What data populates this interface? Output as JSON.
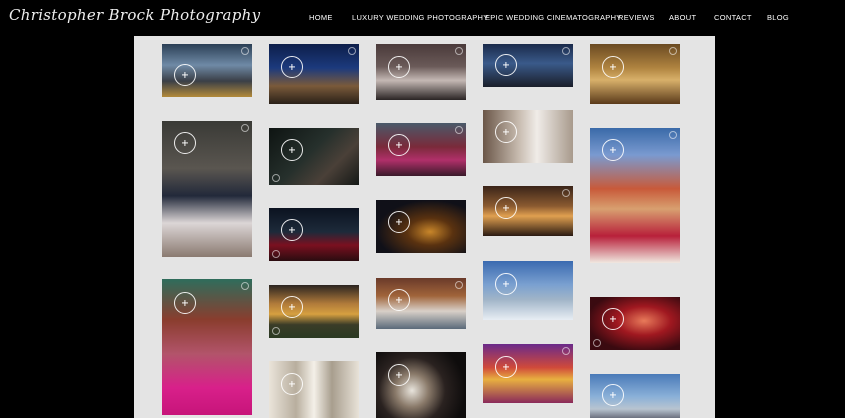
{
  "site": {
    "logo_text": "Christopher Brock Photography"
  },
  "nav": {
    "home": "HOME",
    "luxury": "LUXURY WEDDING PHOTOGRAPHY",
    "cinematography": "EPIC WEDDING CINEMATOGRAPHY",
    "reviews": "REVIEWS",
    "about": "ABOUT",
    "contact": "CONTACT",
    "blog": "BLOG"
  },
  "colors": {
    "page_background": "#000000",
    "gallery_background": "#e4e4e4",
    "nav_text": "#ffffff"
  },
  "gallery": {
    "items": [
      {
        "name": "city-street-couple",
        "icon": "zoom-icon"
      },
      {
        "name": "arch-night-couple",
        "icon": "zoom-icon"
      },
      {
        "name": "ceremony-crowd",
        "icon": "zoom-icon"
      },
      {
        "name": "helicopter-night",
        "icon": "zoom-icon"
      },
      {
        "name": "ballroom-gold",
        "icon": "zoom-icon"
      },
      {
        "name": "couple-formal-portrait",
        "icon": "zoom-icon"
      },
      {
        "name": "forest-night-bride",
        "icon": "zoom-icon"
      },
      {
        "name": "indian-wedding-party",
        "icon": "zoom-icon"
      },
      {
        "name": "church-bride",
        "icon": "zoom-icon"
      },
      {
        "name": "indian-bride-closeup",
        "icon": "zoom-icon"
      },
      {
        "name": "venue-night-red-dress",
        "icon": "zoom-icon"
      },
      {
        "name": "ring-detail-dark",
        "icon": "zoom-icon"
      },
      {
        "name": "chapel-ceremony-lights",
        "icon": "zoom-icon"
      },
      {
        "name": "henna-hands-bride",
        "icon": "zoom-icon"
      },
      {
        "name": "mansion-sunset",
        "icon": "zoom-icon"
      },
      {
        "name": "wedding-party-theater",
        "icon": "zoom-icon"
      },
      {
        "name": "skyline-couple",
        "icon": "zoom-icon"
      },
      {
        "name": "stage-red-lights",
        "icon": "zoom-icon"
      },
      {
        "name": "columns-veranda",
        "icon": "zoom-icon"
      },
      {
        "name": "ring-macro",
        "icon": "zoom-icon"
      },
      {
        "name": "mandap-colorful",
        "icon": "zoom-icon"
      },
      {
        "name": "helicopter-couple",
        "icon": "zoom-icon"
      }
    ]
  }
}
